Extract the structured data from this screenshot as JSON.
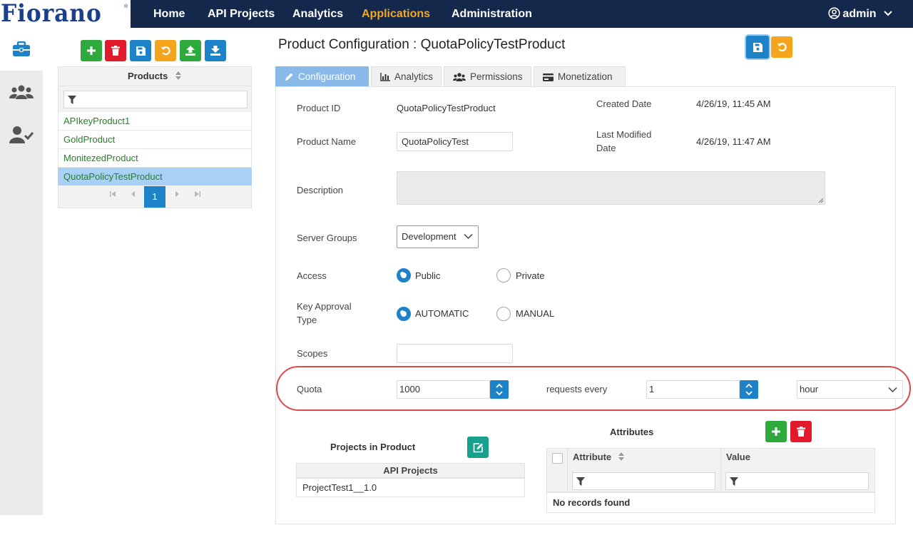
{
  "brand": {
    "logo_text": "Fiorano",
    "reg_mark": "®"
  },
  "nav": {
    "items": [
      {
        "label": "Home"
      },
      {
        "label": "API Projects"
      },
      {
        "label": "Analytics"
      },
      {
        "label": "Applications",
        "active": true
      },
      {
        "label": "Administration"
      }
    ],
    "user": "admin",
    "active_color": "#f5a623"
  },
  "rail": {
    "icons": [
      "briefcase-icon",
      "users-icon",
      "user-check-icon"
    ]
  },
  "toolbar": {
    "icons": [
      "plus-icon",
      "trash-icon",
      "save-icon",
      "undo-icon",
      "upload-icon",
      "download-icon"
    ]
  },
  "products": {
    "header": "Products",
    "items": [
      "APIkeyProduct1",
      "GoldProduct",
      "MonitezedProduct",
      "QuotaPolicyTestProduct"
    ],
    "selected_index": 3,
    "page": "1"
  },
  "page_title": "Product Configuration : QuotaPolicyTestProduct",
  "tabs": [
    {
      "label": "Configuration",
      "icon": "pencil-icon",
      "active": true
    },
    {
      "label": "Analytics",
      "icon": "bar-chart-icon"
    },
    {
      "label": "Permissions",
      "icon": "users-icon"
    },
    {
      "label": "Monetization",
      "icon": "credit-card-icon"
    }
  ],
  "form": {
    "product_id_label": "Product ID",
    "product_id_value": "QuotaPolicyTestProduct",
    "created_label": "Created Date",
    "created_value": "4/26/19, 11:45 AM",
    "product_name_label": "Product Name",
    "product_name_value": "QuotaPolicyTest",
    "modified_label_1": "Last Modified",
    "modified_label_2": "Date",
    "modified_value": "4/26/19, 11:47 AM",
    "description_label": "Description",
    "description_value": "",
    "server_groups_label": "Server Groups",
    "server_groups_value": "Development",
    "access_label": "Access",
    "access_public": "Public",
    "access_private": "Private",
    "access_selected": "Public",
    "key_approval_label_1": "Key Approval",
    "key_approval_label_2": "Type",
    "key_approval_auto": "AUTOMATIC",
    "key_approval_manual": "MANUAL",
    "key_approval_selected": "AUTOMATIC",
    "scopes_label": "Scopes",
    "scopes_value": "",
    "quota_label": "Quota",
    "quota_value": "1000",
    "requests_every_label": "requests every",
    "interval_value": "1",
    "unit_value": "hour"
  },
  "projects": {
    "title": "Projects in Product",
    "column": "API Projects",
    "rows": [
      "ProjectTest1__1.0"
    ]
  },
  "attributes": {
    "title": "Attributes",
    "columns": [
      "Attribute",
      "Value"
    ],
    "empty_text": "No records found"
  },
  "colors": {
    "navbar": "#14284b",
    "primary": "#1e82c8",
    "success": "#2eaa3d",
    "danger": "#e21b2c",
    "warning": "#f5a51c",
    "highlight_ring": "#df4b4b"
  }
}
